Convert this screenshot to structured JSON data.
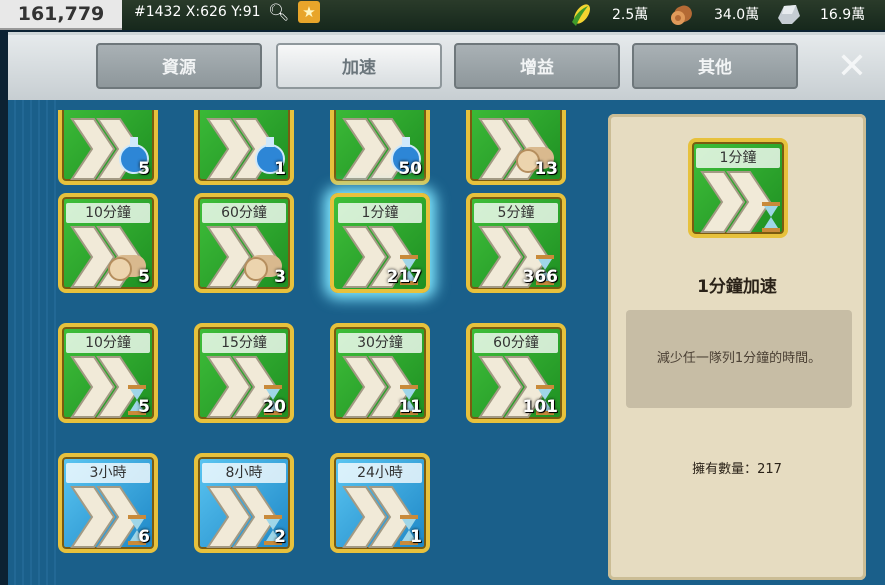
{
  "topbar": {
    "power": "161,779",
    "coords": "#1432 X:626 Y:91",
    "food": "2.5萬",
    "wood": "34.0萬",
    "stone": "16.9萬"
  },
  "tabs": [
    {
      "label": "資源",
      "active": false
    },
    {
      "label": "加速",
      "active": true
    },
    {
      "label": "增益",
      "active": false
    },
    {
      "label": "其他",
      "active": false
    }
  ],
  "rows": [
    [
      {
        "label": "",
        "count": "5",
        "kind": "potion"
      },
      {
        "label": "",
        "count": "1",
        "kind": "potion"
      },
      {
        "label": "",
        "count": "50",
        "kind": "potion"
      },
      {
        "label": "",
        "count": "13",
        "kind": "log"
      }
    ],
    [
      {
        "label": "10分鐘",
        "count": "5",
        "kind": "log"
      },
      {
        "label": "60分鐘",
        "count": "3",
        "kind": "log"
      },
      {
        "label": "1分鐘",
        "count": "217",
        "kind": "hourglass",
        "selected": true
      },
      {
        "label": "5分鐘",
        "count": "366",
        "kind": "hourglass"
      }
    ],
    [
      {
        "label": "10分鐘",
        "count": "5",
        "kind": "hourglass"
      },
      {
        "label": "15分鐘",
        "count": "20",
        "kind": "hourglass"
      },
      {
        "label": "30分鐘",
        "count": "11",
        "kind": "hourglass"
      },
      {
        "label": "60分鐘",
        "count": "101",
        "kind": "hourglass"
      }
    ],
    [
      {
        "label": "3小時",
        "count": "6",
        "kind": "hourglass",
        "blue": true
      },
      {
        "label": "8小時",
        "count": "2",
        "kind": "hourglass",
        "blue": true
      },
      {
        "label": "24小時",
        "count": "1",
        "kind": "hourglass",
        "blue": true
      }
    ]
  ],
  "detail": {
    "item_label": "1分鐘",
    "title": "1分鐘加速",
    "description": "減少任一隊列1分鐘的時間。",
    "owned": "擁有數量：217"
  },
  "colors": {
    "green_item": "#2aa82e",
    "blue_item": "#3aa6e0",
    "gold_border": "#e7c13c",
    "frame_blue": "#1a5f8a",
    "panel_parchment": "#e6dcc1"
  }
}
